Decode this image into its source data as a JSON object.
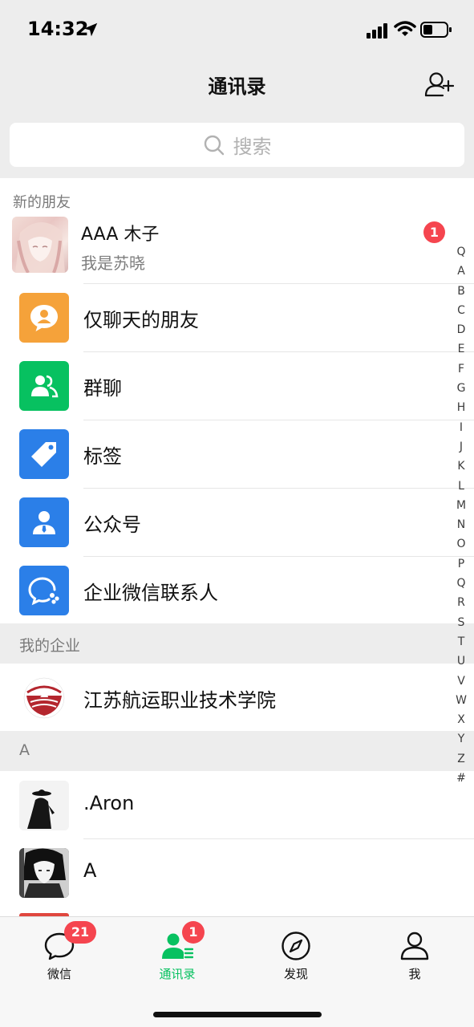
{
  "status_bar": {
    "time": "14:32"
  },
  "header": {
    "title": "通讯录",
    "add_icon": "add-friend-icon"
  },
  "search": {
    "placeholder": "搜索"
  },
  "new_friends": {
    "section_label": "新的朋友",
    "name": "AAA 木子",
    "message": "我是苏晓",
    "badge": "1"
  },
  "menu_items": [
    {
      "label": "仅聊天的朋友",
      "icon": "chat-only-friends-icon",
      "color": "#f5a23a"
    },
    {
      "label": "群聊",
      "icon": "group-chat-icon",
      "color": "#07c160"
    },
    {
      "label": "标签",
      "icon": "tag-icon",
      "color": "#2b7fe8"
    },
    {
      "label": "公众号",
      "icon": "official-account-icon",
      "color": "#2b7fe8"
    },
    {
      "label": "企业微信联系人",
      "icon": "wecom-contacts-icon",
      "color": "#2b7fe8"
    }
  ],
  "enterprise": {
    "section_label": "我的企业",
    "items": [
      {
        "label": "江苏航运职业技术学院"
      }
    ]
  },
  "contacts": {
    "section_label": "A",
    "items": [
      {
        "name": ".Aron"
      },
      {
        "name": "A"
      }
    ]
  },
  "alphabet_index": [
    "Q",
    "A",
    "B",
    "C",
    "D",
    "E",
    "F",
    "G",
    "H",
    "I",
    "J",
    "K",
    "L",
    "M",
    "N",
    "O",
    "P",
    "Q",
    "R",
    "S",
    "T",
    "U",
    "V",
    "W",
    "X",
    "Y",
    "Z",
    "#"
  ],
  "tab_bar": {
    "tabs": [
      {
        "label": "微信",
        "badge": "21",
        "icon": "chat-bubble-icon"
      },
      {
        "label": "通讯录",
        "badge": "1",
        "icon": "contacts-icon",
        "active": true
      },
      {
        "label": "发现",
        "icon": "compass-icon"
      },
      {
        "label": "我",
        "icon": "person-icon"
      }
    ]
  },
  "colors": {
    "accent": "#07c160",
    "badge": "#f5454f",
    "background_gray": "#ededed"
  }
}
